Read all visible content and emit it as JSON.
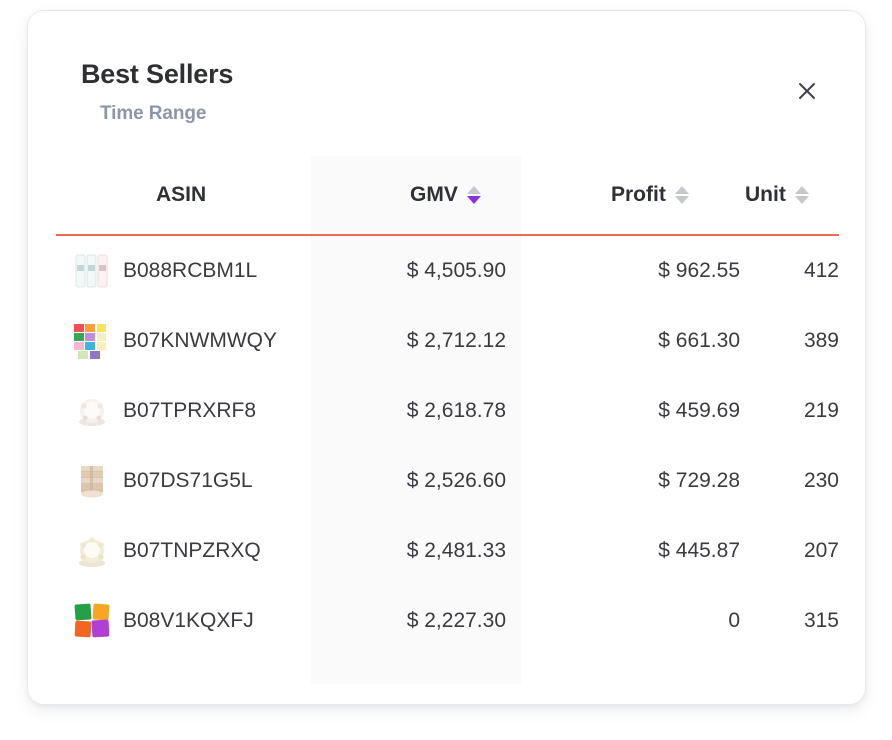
{
  "header": {
    "title": "Best Sellers",
    "subtitle": "Time Range",
    "close_label": "×"
  },
  "table": {
    "columns": [
      {
        "key": "asin",
        "label": "ASIN",
        "sortable": true,
        "sort_state": "none"
      },
      {
        "key": "gmv",
        "label": "GMV",
        "sortable": true,
        "sort_state": "desc"
      },
      {
        "key": "profit",
        "label": "Profit",
        "sortable": true,
        "sort_state": "none"
      },
      {
        "key": "unit",
        "label": "Unit",
        "sortable": true,
        "sort_state": "none"
      }
    ],
    "rows": [
      {
        "asin": "B088RCBM1L",
        "gmv": "$ 4,505.90",
        "profit": "$ 962.55",
        "unit": "412",
        "thumb": "strips-thumbnail"
      },
      {
        "asin": "B07KNWMWQY",
        "gmv": "$ 2,712.12",
        "profit": "$ 661.30",
        "unit": "389",
        "thumb": "color-grid-thumbnail"
      },
      {
        "asin": "B07TPRXRF8",
        "gmv": "$ 2,618.78",
        "profit": "$ 459.69",
        "unit": "219",
        "thumb": "round-white-thumbnail"
      },
      {
        "asin": "B07DS71G5L",
        "gmv": "$ 2,526.60",
        "profit": "$ 729.28",
        "unit": "230",
        "thumb": "stacked-tan-thumbnail"
      },
      {
        "asin": "B07TNPZRXQ",
        "gmv": "$ 2,481.33",
        "profit": "$ 445.87",
        "unit": "207",
        "thumb": "round-cream-thumbnail"
      },
      {
        "asin": "B08V1KQXFJ",
        "gmv": "$ 2,227.30",
        "profit": "0",
        "unit": "315",
        "thumb": "four-squares-thumbnail"
      }
    ]
  },
  "colors": {
    "divider": "#ec6a56",
    "active_sort": "#8b2fe0",
    "inactive_sort": "#c6c7cc",
    "subtitle": "#8d95a8",
    "gmv_column_highlight": "#fafafa"
  }
}
